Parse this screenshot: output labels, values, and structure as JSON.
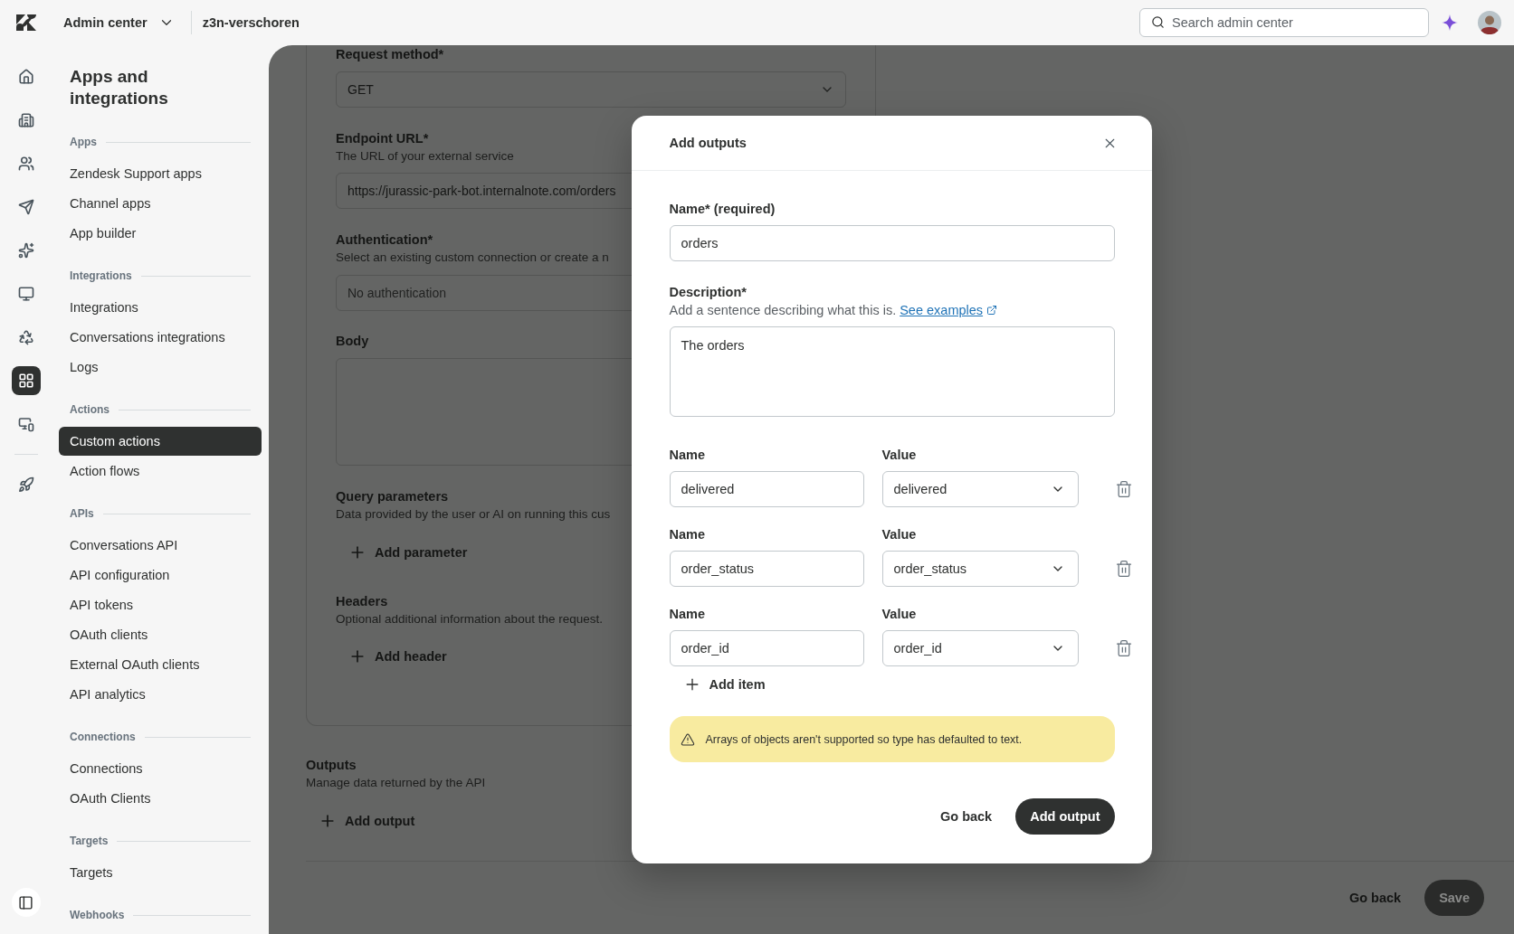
{
  "top_bar": {
    "product": "Admin center",
    "account": "z3n-verschoren",
    "search": {
      "placeholder": "Search admin center"
    }
  },
  "rail_groups": [
    [
      {
        "kind": "home",
        "selected": false
      },
      {
        "kind": "building",
        "selected": false
      },
      {
        "kind": "users",
        "selected": false
      },
      {
        "kind": "send",
        "selected": false
      },
      {
        "kind": "sparkle",
        "selected": false
      },
      {
        "kind": "monitor",
        "selected": false
      },
      {
        "kind": "recycle",
        "selected": false
      },
      {
        "kind": "apps",
        "selected": true
      },
      {
        "kind": "devices",
        "selected": false
      }
    ],
    [
      {
        "kind": "rocket",
        "selected": false
      }
    ]
  ],
  "nav": {
    "title": "Apps and integrations",
    "sections": [
      {
        "heading": "Apps",
        "items": [
          {
            "label": "Zendesk Support apps",
            "selected": false
          },
          {
            "label": "Channel apps",
            "selected": false
          },
          {
            "label": "App builder",
            "selected": false
          }
        ]
      },
      {
        "heading": "Integrations",
        "items": [
          {
            "label": "Integrations",
            "selected": false
          },
          {
            "label": "Conversations integrations",
            "selected": false
          },
          {
            "label": "Logs",
            "selected": false
          }
        ]
      },
      {
        "heading": "Actions",
        "items": [
          {
            "label": "Custom actions",
            "selected": true
          },
          {
            "label": "Action flows",
            "selected": false
          }
        ]
      },
      {
        "heading": "APIs",
        "items": [
          {
            "label": "Conversations API",
            "selected": false
          },
          {
            "label": "API configuration",
            "selected": false
          },
          {
            "label": "API tokens",
            "selected": false
          },
          {
            "label": "OAuth clients",
            "selected": false
          },
          {
            "label": "External OAuth clients",
            "selected": false
          },
          {
            "label": "API analytics",
            "selected": false
          }
        ]
      },
      {
        "heading": "Connections",
        "items": [
          {
            "label": "Connections",
            "selected": false
          },
          {
            "label": "OAuth Clients",
            "selected": false
          }
        ]
      },
      {
        "heading": "Targets",
        "items": [
          {
            "label": "Targets",
            "selected": false
          }
        ]
      },
      {
        "heading": "Webhooks"
      }
    ]
  },
  "form": {
    "request_method": {
      "label": "Request method*",
      "value": "GET"
    },
    "endpoint": {
      "label": "Endpoint URL*",
      "hint": "The URL of your external service",
      "value": "https://jurassic-park-bot.internalnote.com/orders"
    },
    "authentication": {
      "label": "Authentication*",
      "hint": "Select an existing custom connection or create a n",
      "placeholder": "No authentication"
    },
    "body": {
      "label": "Body"
    },
    "query_parameters": {
      "title": "Query parameters",
      "hint": "Data provided by the user or AI on running this cus",
      "action": "Add parameter"
    },
    "headers": {
      "title": "Headers",
      "hint": "Optional additional information about the request.",
      "action": "Add header"
    },
    "outputs": {
      "title": "Outputs",
      "hint": "Manage data returned by the API",
      "action": "Add output"
    },
    "buttons": [
      {
        "label": "Go back",
        "kind": "secondary"
      },
      {
        "label": "Save",
        "kind": "primary"
      }
    ]
  },
  "modal": {
    "title": "Add outputs",
    "name": {
      "label": "Name* (required)",
      "value": "orders"
    },
    "description": {
      "label": "Description*",
      "hint": "Add a sentence describing what this is.",
      "link": "See examples",
      "value": "The orders"
    },
    "items": [
      {
        "name_label": "Name",
        "name": "delivered",
        "value_label": "Value",
        "value": "delivered"
      },
      {
        "name_label": "Name",
        "name": "order_status",
        "value_label": "Value",
        "value": "order_status"
      },
      {
        "name_label": "Name",
        "name": "order_id",
        "value_label": "Value",
        "value": "order_id"
      }
    ],
    "add_item": "Add item",
    "alert": "Arrays of objects aren't supported so type has defaulted to text.",
    "buttons": [
      {
        "label": "Go back",
        "kind": "secondary"
      },
      {
        "label": "Add output",
        "kind": "primary"
      }
    ]
  }
}
